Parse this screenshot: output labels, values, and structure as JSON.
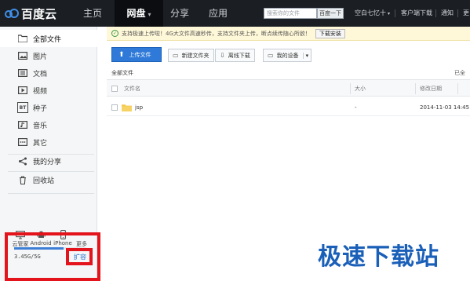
{
  "topbar": {
    "logo_text": "百度云",
    "nav": [
      {
        "label": "主页"
      },
      {
        "label": "网盘"
      },
      {
        "label": "分享"
      },
      {
        "label": "应用"
      }
    ],
    "search_placeholder": "搜索你的文件",
    "search_button": "百度一下",
    "user": "空白七忆十",
    "client_download": "客户端下载",
    "notifications": "通知",
    "more": "更"
  },
  "sidebar": {
    "items": [
      {
        "label": "全部文件",
        "icon": "folder-icon"
      },
      {
        "label": "图片",
        "icon": "image-icon"
      },
      {
        "label": "文档",
        "icon": "document-icon"
      },
      {
        "label": "视频",
        "icon": "video-icon"
      },
      {
        "label": "种子",
        "icon": "torrent-icon"
      },
      {
        "label": "音乐",
        "icon": "music-icon"
      },
      {
        "label": "其它",
        "icon": "other-icon"
      }
    ],
    "share_label": "我的分享",
    "recycle_label": "回收站",
    "torrent_badge": "BT",
    "devices": [
      {
        "label": "云管家",
        "icon": "monitor-icon"
      },
      {
        "label": "Android",
        "icon": "android-icon"
      },
      {
        "label": "iPhone",
        "icon": "iphone-icon"
      },
      {
        "label": "更多",
        "icon": "more-icon"
      }
    ],
    "quota_text": "3.45G/5G",
    "quota_fraction": 0.69,
    "expand_label": "扩容"
  },
  "notice": {
    "text": "支持极速上传啦！4G大文件高速秒传，支持文件夹上传，断点续传随心所欲！",
    "button": "下载安装"
  },
  "toolbar": {
    "upload": "上传文件",
    "new_folder": "新建文件夹",
    "offline_download": "离线下载",
    "my_devices": "我的设备"
  },
  "breadcrumb": "全部文件",
  "breadcrumb_right": "已全",
  "table": {
    "headers": {
      "name": "文件名",
      "size": "大小",
      "date": "修改日期"
    },
    "rows": [
      {
        "name": "jsp",
        "size": "-",
        "date": "2014-11-03 14:45"
      }
    ]
  },
  "watermark": "极速下载站",
  "colors": {
    "accent": "#2f7ad8",
    "highlight": "#e3141b",
    "topbar": "#1b1f24"
  }
}
